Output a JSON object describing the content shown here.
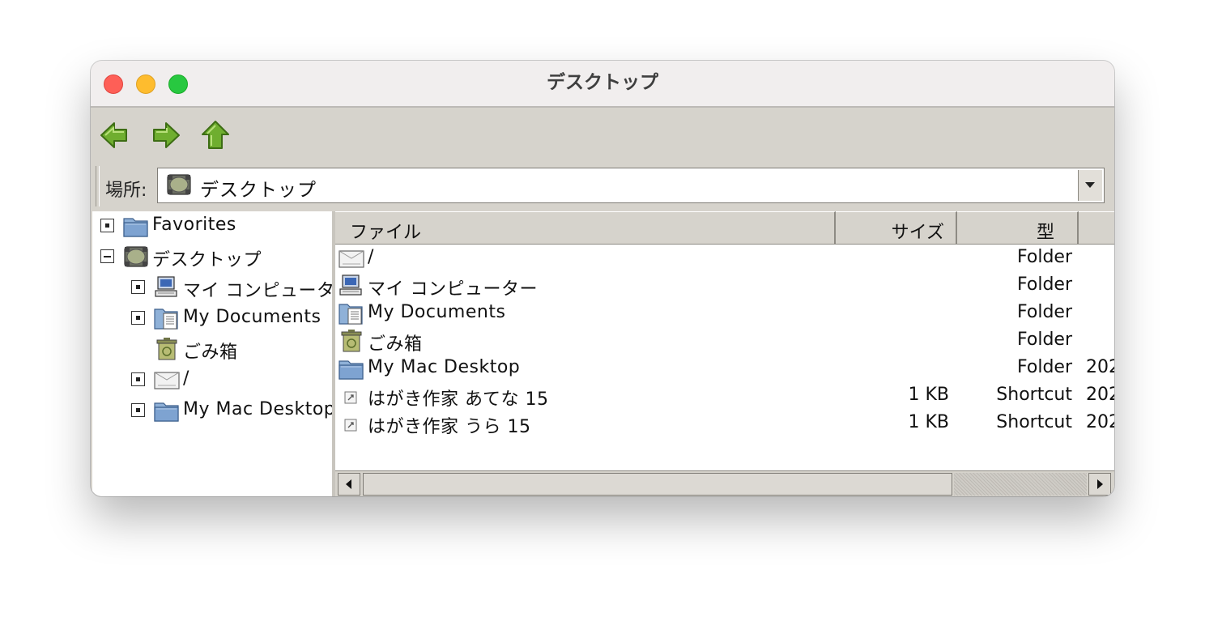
{
  "window": {
    "title": "デスクトップ"
  },
  "location": {
    "label": "場所:",
    "value": "デスクトップ"
  },
  "tree": {
    "items": [
      {
        "label": "Favorites",
        "icon": "folder-icon",
        "state": "collapsed"
      },
      {
        "label": "デスクトップ",
        "icon": "desktop-icon",
        "state": "expanded"
      },
      {
        "label": "マイ コンピューター",
        "icon": "computer-icon",
        "state": "collapsed"
      },
      {
        "label": "My Documents",
        "icon": "documents-folder-icon",
        "state": "collapsed"
      },
      {
        "label": "ごみ箱",
        "icon": "trash-icon",
        "state": "leaf"
      },
      {
        "label": "/",
        "icon": "drive-icon",
        "state": "collapsed"
      },
      {
        "label": "My Mac Desktop",
        "icon": "folder-icon",
        "state": "collapsed"
      }
    ]
  },
  "columns": {
    "name": "ファイル",
    "size": "サイズ",
    "type": "型"
  },
  "files": [
    {
      "name": "/",
      "size": "",
      "type": "Folder",
      "date": "",
      "icon": "drive-icon"
    },
    {
      "name": "マイ コンピューター",
      "size": "",
      "type": "Folder",
      "date": "",
      "icon": "computer-icon"
    },
    {
      "name": "My Documents",
      "size": "",
      "type": "Folder",
      "date": "",
      "icon": "documents-folder-icon"
    },
    {
      "name": "ごみ箱",
      "size": "",
      "type": "Folder",
      "date": "",
      "icon": "trash-icon"
    },
    {
      "name": "My Mac Desktop",
      "size": "",
      "type": "Folder",
      "date": "202",
      "icon": "folder-icon"
    },
    {
      "name": "はがき作家 あてな 15",
      "size": "1 KB",
      "type": "Shortcut",
      "date": "202",
      "icon": "shortcut-icon"
    },
    {
      "name": "はがき作家 うら 15",
      "size": "1 KB",
      "type": "Shortcut",
      "date": "202",
      "icon": "shortcut-icon"
    }
  ],
  "colors": {
    "titlebar": "#f1eeee",
    "panel": "#d6d3cc",
    "arrow_green": "#6fae2f"
  }
}
